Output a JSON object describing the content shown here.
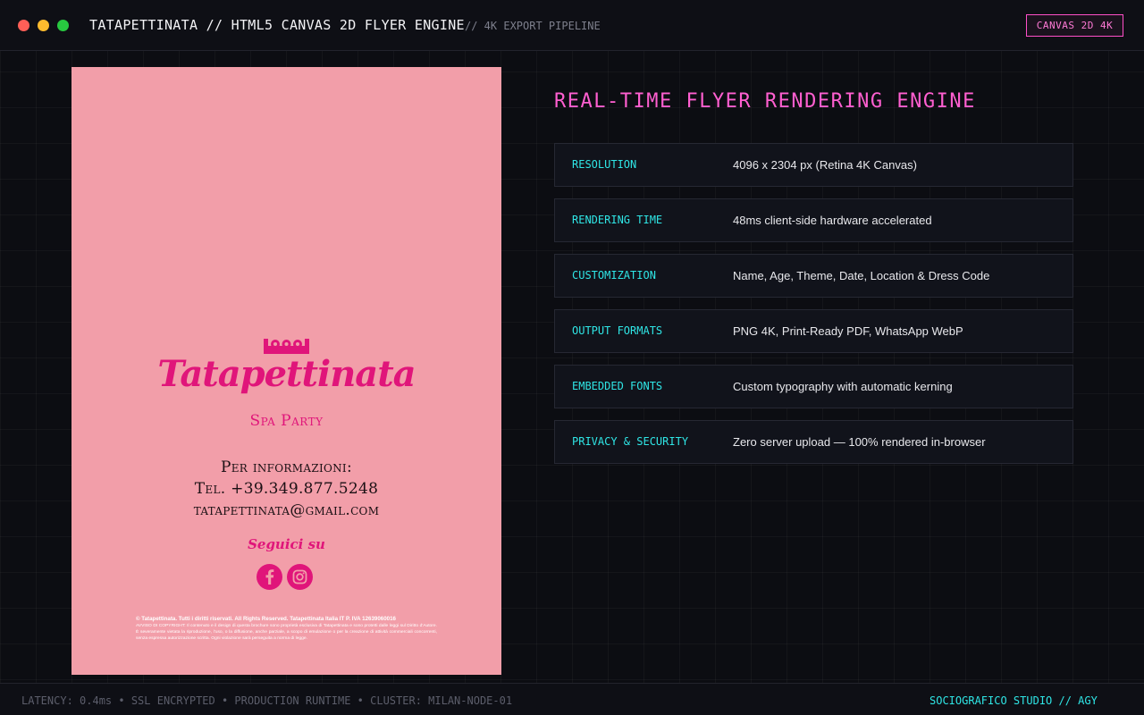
{
  "window": {
    "title": "TATAPETTINATA // HTML5 CANVAS 2D FLYER ENGINE",
    "subtitle": "// 4K EXPORT PIPELINE",
    "badge": "CANVAS 2D 4K"
  },
  "flyer": {
    "background_color": "#f29ea9",
    "accent_color": "#e0157a",
    "brand_name": "Tatapettinata",
    "brand_subtitle": "Spa Party",
    "info_heading": "Per informazioni:",
    "phone": "Tel. +39.349.877.5248",
    "email": "tatapettinata@gmail.com",
    "follow_label": "Seguici su",
    "social_icons": [
      "facebook-icon",
      "instagram-icon"
    ],
    "legal_title": "© Tatapettinata. Tutti i diritti riservati. All Rights Reserved. Tatapettinata Italia IT P. IVA 12639060016",
    "legal_body": "AVVISO DI COPYRIGHT: Il contenuto e il design di questa brochure sono proprietà esclusiva di Tatapettinata e sono protetti dalle leggi sul Diritto d'Autore. È severamente vietata la riproduzione, l'uso, o la diffusione, anche parziale, a scopo di emulazione o per la creazione di attività commerciali concorrenti, senza espressa autorizzazione scritta. Ogni violazione sarà perseguita a norma di legge."
  },
  "panel": {
    "heading": "REAL-TIME FLYER RENDERING ENGINE",
    "heading_color": "#ff5fd0",
    "label_color": "#2fe6e6",
    "specs": [
      {
        "label": "RESOLUTION",
        "value": "4096 x 2304 px (Retina 4K Canvas)"
      },
      {
        "label": "RENDERING TIME",
        "value": "48ms client-side hardware accelerated"
      },
      {
        "label": "CUSTOMIZATION",
        "value": "Name, Age, Theme, Date, Location & Dress Code"
      },
      {
        "label": "OUTPUT FORMATS",
        "value": "PNG 4K, Print-Ready PDF, WhatsApp WebP"
      },
      {
        "label": "EMBEDDED FONTS",
        "value": "Custom typography with automatic kerning"
      },
      {
        "label": "PRIVACY & SECURITY",
        "value": "Zero server upload — 100% rendered in-browser"
      }
    ]
  },
  "footer": {
    "status": "LATENCY: 0.4ms • SSL ENCRYPTED • PRODUCTION RUNTIME • CLUSTER: MILAN-NODE-01",
    "brand": "SOCIOGRAFICO STUDIO // AGY"
  }
}
